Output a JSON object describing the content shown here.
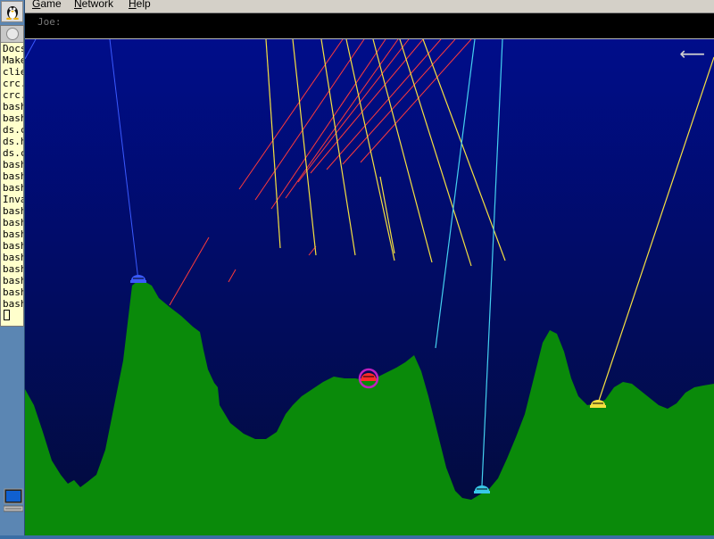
{
  "menubar": {
    "items": [
      {
        "label": "Game",
        "accel": "G"
      },
      {
        "label": "Network",
        "accel": "N"
      },
      {
        "label": "Help",
        "accel": "H"
      }
    ]
  },
  "chat": {
    "label": "Joe:"
  },
  "file_panel": {
    "items": [
      "Docs",
      "Make",
      "clie",
      "crc.",
      "crc.",
      "bash",
      "bash",
      "ds.c",
      "ds.h",
      "ds.c",
      "bash",
      "bash",
      "bash",
      "Inva",
      "bash",
      "bash",
      "bash",
      "bash",
      "bash",
      "bash",
      "bash",
      "bash",
      "bash"
    ]
  },
  "icons": {
    "os_logo": "tux-icon",
    "back": "left-arrow-icon",
    "desktop_computer": "computer-icon"
  },
  "game": {
    "sky_color_top": "#000d8a",
    "sky_color_bottom": "#020b3a",
    "terrain_color": "#0a8a0a",
    "tanks": [
      {
        "name": "blue-tank",
        "color": "#3a5aff"
      },
      {
        "name": "red-tank",
        "color": "#ff2a2a",
        "selected": true
      },
      {
        "name": "cyan-tank",
        "color": "#38c8e8"
      },
      {
        "name": "yellow-tank",
        "color": "#f5e040"
      }
    ],
    "selection_ring_color": "#c020c0"
  }
}
